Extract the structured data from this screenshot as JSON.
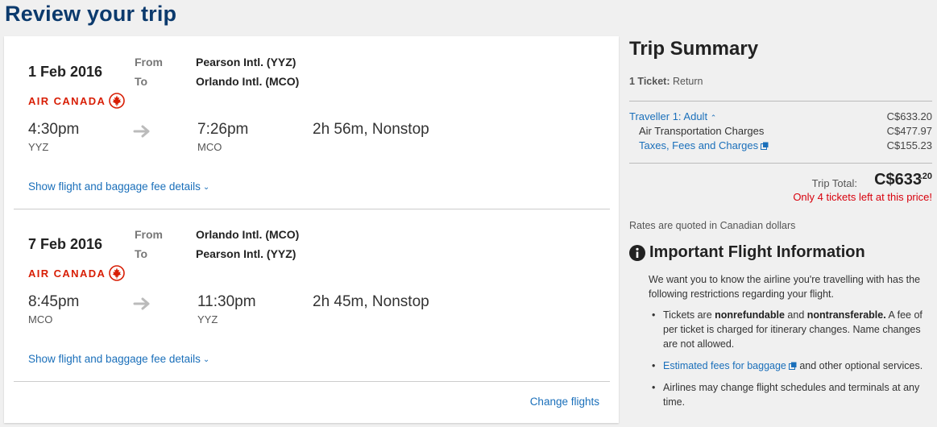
{
  "page": {
    "title": "Review your trip"
  },
  "flights": [
    {
      "date": "1 Feb 2016",
      "from_label": "From",
      "to_label": "To",
      "from": "Pearson Intl. (YYZ)",
      "to": "Orlando Intl. (MCO)",
      "airline": "AIR CANADA",
      "dep_time": "4:30pm",
      "dep_code": "YYZ",
      "arr_time": "7:26pm",
      "arr_code": "MCO",
      "duration": "2h 56m, Nonstop",
      "details_link": "Show flight and baggage fee details"
    },
    {
      "date": "7 Feb 2016",
      "from_label": "From",
      "to_label": "To",
      "from": "Orlando Intl. (MCO)",
      "to": "Pearson Intl. (YYZ)",
      "airline": "AIR CANADA",
      "dep_time": "8:45pm",
      "dep_code": "MCO",
      "arr_time": "11:30pm",
      "arr_code": "YYZ",
      "duration": "2h 45m, Nonstop",
      "details_link": "Show flight and baggage fee details"
    }
  ],
  "change_flights": "Change flights",
  "summary": {
    "title": "Trip Summary",
    "ticket_count": "1 Ticket:",
    "ticket_type": "Return",
    "traveller_label": "Traveller 1: Adult",
    "traveller_total": "C$633.20",
    "air_label": "Air Transportation Charges",
    "air_value": "C$477.97",
    "taxes_label": "Taxes, Fees and Charges",
    "taxes_value": "C$155.23",
    "total_label": "Trip Total:",
    "total_amount": "C$633",
    "total_cents": ".20",
    "availability": "Only 4 tickets left at this price!",
    "rates_note": "Rates are quoted in Canadian dollars"
  },
  "info": {
    "title": "Important Flight Information",
    "intro": "We want you to know the airline you're travelling with has the following restrictions regarding your flight.",
    "b1_pre": "Tickets are ",
    "b1_bold1": "nonrefundable",
    "b1_mid": " and ",
    "b1_bold2": "nontransferable.",
    "b1_post": " A fee of per ticket is charged for itinerary changes. Name changes are not allowed.",
    "b2_link": "Estimated fees for baggage",
    "b2_post": " and other optional services.",
    "b3": "Airlines may change flight schedules and terminals at any time."
  },
  "colors": {
    "brand": "#0b3a6d",
    "link": "#1a6fba",
    "airline_red": "#d81e05",
    "alert": "#d8000c"
  },
  "icons": [
    "maple-leaf-icon",
    "arrow-right-icon",
    "chevron-down-icon",
    "chevron-up-icon",
    "external-link-icon",
    "info-icon"
  ]
}
